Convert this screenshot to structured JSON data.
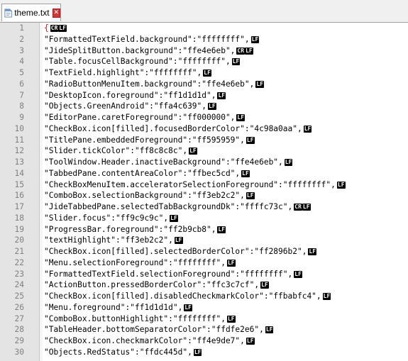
{
  "tab": {
    "label": "theme.txt",
    "close_glyph": "✕"
  },
  "lines": [
    {
      "num": "1",
      "text": "{",
      "eol": [
        "CR",
        "LF"
      ]
    },
    {
      "num": "2",
      "text": "\"FormattedTextField.background\":\"ffffffff\",",
      "eol": [
        "LF"
      ]
    },
    {
      "num": "3",
      "text": "\"JideSplitButton.background\":\"ffe4e6eb\",",
      "eol": [
        "CR",
        "LF"
      ]
    },
    {
      "num": "4",
      "text": "\"Table.focusCellBackground\":\"ffffffff\",",
      "eol": [
        "LF"
      ]
    },
    {
      "num": "5",
      "text": "\"TextField.highlight\":\"ffffffff\",",
      "eol": [
        "LF"
      ]
    },
    {
      "num": "6",
      "text": "\"RadioButtonMenuItem.background\":\"ffe4e6eb\",",
      "eol": [
        "LF"
      ]
    },
    {
      "num": "7",
      "text": "\"DesktopIcon.foreground\":\"ff1d1d1d\",",
      "eol": [
        "LF"
      ]
    },
    {
      "num": "8",
      "text": "\"Objects.GreenAndroid\":\"ffa4c639\",",
      "eol": [
        "LF"
      ]
    },
    {
      "num": "9",
      "text": "\"EditorPane.caretForeground\":\"ff000000\",",
      "eol": [
        "LF"
      ]
    },
    {
      "num": "10",
      "text": "\"CheckBox.icon[filled].focusedBorderColor\":\"4c98a0aa\",",
      "eol": [
        "LF"
      ]
    },
    {
      "num": "11",
      "text": "\"TitlePane.embeddedForeground\":\"ff595959\",",
      "eol": [
        "LF"
      ]
    },
    {
      "num": "12",
      "text": "\"Slider.tickColor\":\"ff8c8c8c\",",
      "eol": [
        "LF"
      ]
    },
    {
      "num": "13",
      "text": "\"ToolWindow.Header.inactiveBackground\":\"ffe4e6eb\",",
      "eol": [
        "LF"
      ]
    },
    {
      "num": "14",
      "text": "\"TabbedPane.contentAreaColor\":\"ffbec5cd\",",
      "eol": [
        "LF"
      ]
    },
    {
      "num": "15",
      "text": "\"CheckBoxMenuItem.acceleratorSelectionForeground\":\"ffffffff\",",
      "eol": [
        "LF"
      ]
    },
    {
      "num": "16",
      "text": "\"ComboBox.selectionBackground\":\"ff3eb2c2\",",
      "eol": [
        "LF"
      ]
    },
    {
      "num": "17",
      "text": "\"JideTabbedPane.selectedTabBackgroundDk\":\"ffffc73c\",",
      "eol": [
        "CR",
        "LF"
      ]
    },
    {
      "num": "18",
      "text": "\"Slider.focus\":\"ff9c9c9c\",",
      "eol": [
        "LF"
      ]
    },
    {
      "num": "19",
      "text": "\"ProgressBar.foreground\":\"ff2b9cb8\",",
      "eol": [
        "LF"
      ]
    },
    {
      "num": "20",
      "text": "\"textHighlight\":\"ff3eb2c2\",",
      "eol": [
        "LF"
      ]
    },
    {
      "num": "21",
      "text": "\"CheckBox.icon[filled].selectedBorderColor\":\"ff2896b2\",",
      "eol": [
        "LF"
      ]
    },
    {
      "num": "22",
      "text": "\"Menu.selectionForeground\":\"ffffffff\",",
      "eol": [
        "LF"
      ]
    },
    {
      "num": "23",
      "text": "\"FormattedTextField.selectionForeground\":\"ffffffff\",",
      "eol": [
        "LF"
      ]
    },
    {
      "num": "24",
      "text": "\"ActionButton.pressedBorderColor\":\"ffc3c7cf\",",
      "eol": [
        "LF"
      ]
    },
    {
      "num": "25",
      "text": "\"CheckBox.icon[filled].disabledCheckmarkColor\":\"ffbabfc4\",",
      "eol": [
        "LF"
      ]
    },
    {
      "num": "26",
      "text": "\"Menu.foreground\":\"ff1d1d1d\",",
      "eol": [
        "LF"
      ]
    },
    {
      "num": "27",
      "text": "\"ComboBox.buttonHighlight\":\"ffffffff\",",
      "eol": [
        "LF"
      ]
    },
    {
      "num": "28",
      "text": "\"TableHeader.bottomSeparatorColor\":\"ffdfe2e6\",",
      "eol": [
        "LF"
      ]
    },
    {
      "num": "29",
      "text": "\"CheckBox.icon.checkmarkColor\":\"ff4e9de7\",",
      "eol": [
        "LF"
      ]
    },
    {
      "num": "30",
      "text": "\"Objects.RedStatus\":\"ffdc445d\",",
      "eol": [
        "LF"
      ]
    }
  ],
  "colors": {
    "brace": "#ff0000",
    "line_number": "#808080",
    "gutter": "#e4e4e4"
  }
}
